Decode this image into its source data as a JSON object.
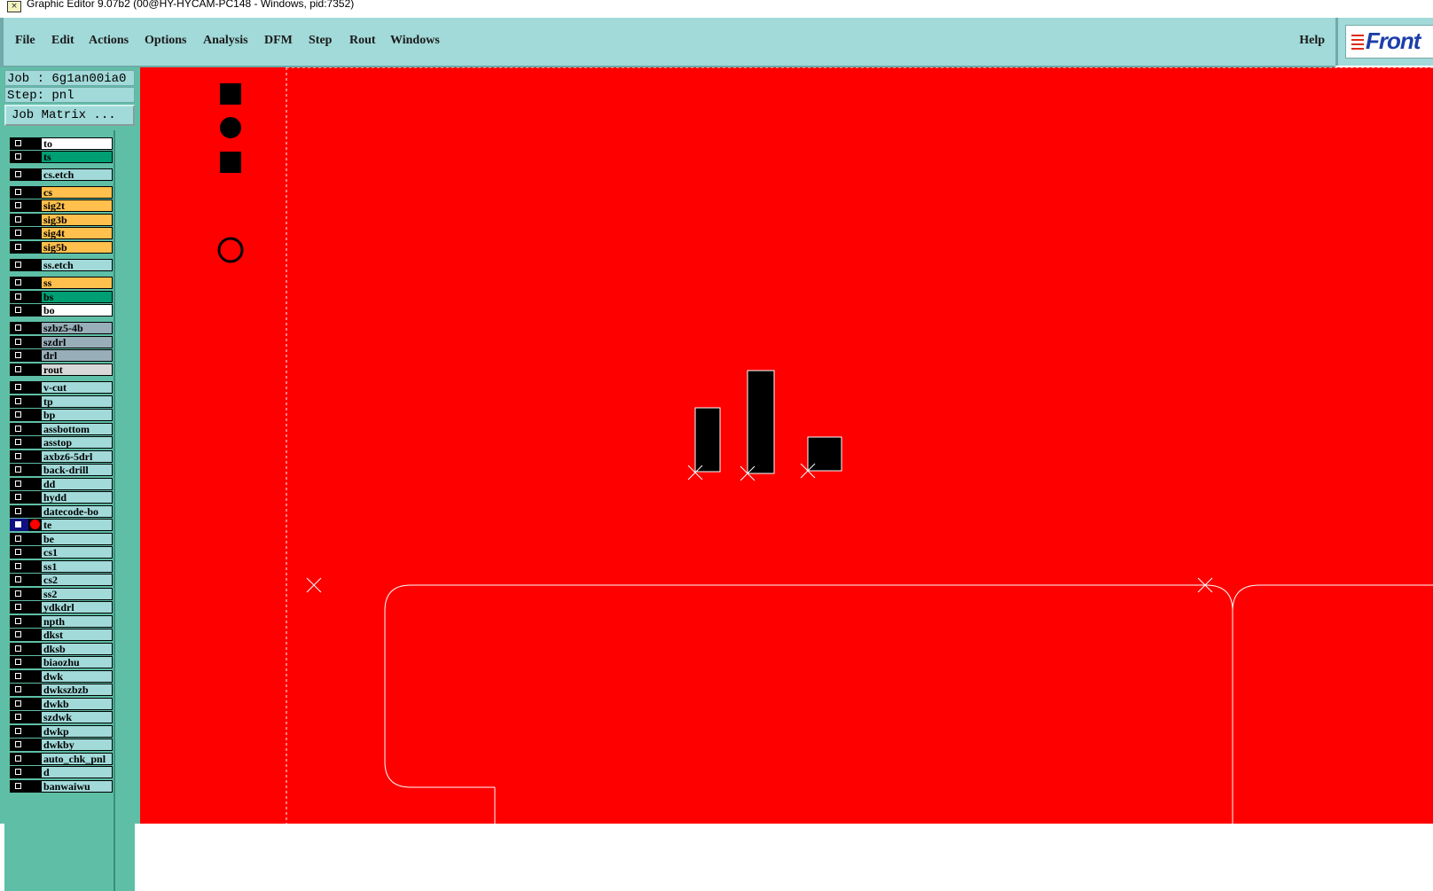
{
  "window": {
    "title": "Graphic Editor 9.07b2 (00@HY-HYCAM-PC148 - Windows, pid:7352)",
    "icon": "app-icon"
  },
  "menu": {
    "items": [
      "File",
      "Edit",
      "Actions",
      "Options",
      "Analysis",
      "DFM",
      "Step",
      "Rout",
      "Windows"
    ],
    "help": "Help"
  },
  "logo": {
    "text": "Front"
  },
  "job": {
    "job_label": "Job : 6g1an00ia0",
    "step_label": "Step: pnl",
    "matrix_button": "Job Matrix ..."
  },
  "layers": [
    {
      "name": "to",
      "color": "#ffffff"
    },
    {
      "name": "ts",
      "color": "#009e73"
    },
    {
      "name": "cs.etch",
      "color": "#a2d9d9"
    },
    {
      "name": "cs",
      "color": "#ffc04d"
    },
    {
      "name": "sig2t",
      "color": "#ffc04d"
    },
    {
      "name": "sig3b",
      "color": "#ffc04d"
    },
    {
      "name": "sig4t",
      "color": "#ffc04d"
    },
    {
      "name": "sig5b",
      "color": "#ffc04d"
    },
    {
      "name": "ss.etch",
      "color": "#a2d9d9"
    },
    {
      "name": "ss",
      "color": "#ffc04d"
    },
    {
      "name": "bs",
      "color": "#009e73"
    },
    {
      "name": "bo",
      "color": "#ffffff"
    },
    {
      "name": "szbz5-4b",
      "color": "#98aeb8"
    },
    {
      "name": "szdrl",
      "color": "#98aeb8"
    },
    {
      "name": "drl",
      "color": "#98aeb8"
    },
    {
      "name": "rout",
      "color": "#d8d8d8"
    },
    {
      "name": "v-cut",
      "color": "#a2d9d9"
    },
    {
      "name": "tp",
      "color": "#a2d9d9"
    },
    {
      "name": "bp",
      "color": "#a2d9d9"
    },
    {
      "name": "assbottom",
      "color": "#a2d9d9"
    },
    {
      "name": "asstop",
      "color": "#a2d9d9"
    },
    {
      "name": "axbz6-5drl",
      "color": "#a2d9d9"
    },
    {
      "name": "back-drill",
      "color": "#a2d9d9"
    },
    {
      "name": "dd",
      "color": "#a2d9d9"
    },
    {
      "name": "hydd",
      "color": "#a2d9d9"
    },
    {
      "name": "datecode-bo",
      "color": "#a2d9d9"
    },
    {
      "name": "te",
      "color": "#a2d9d9",
      "active": true
    },
    {
      "name": "be",
      "color": "#a2d9d9"
    },
    {
      "name": "cs1",
      "color": "#a2d9d9"
    },
    {
      "name": "ss1",
      "color": "#a2d9d9"
    },
    {
      "name": "cs2",
      "color": "#a2d9d9"
    },
    {
      "name": "ss2",
      "color": "#a2d9d9"
    },
    {
      "name": "ydkdrl",
      "color": "#a2d9d9"
    },
    {
      "name": "npth",
      "color": "#a2d9d9"
    },
    {
      "name": "dkst",
      "color": "#a2d9d9"
    },
    {
      "name": "dksb",
      "color": "#a2d9d9"
    },
    {
      "name": "biaozhu",
      "color": "#a2d9d9"
    },
    {
      "name": "dwk",
      "color": "#a2d9d9"
    },
    {
      "name": "dwkszbzb",
      "color": "#a2d9d9"
    },
    {
      "name": "dwkb",
      "color": "#a2d9d9"
    },
    {
      "name": "szdwk",
      "color": "#a2d9d9"
    },
    {
      "name": "dwkp",
      "color": "#a2d9d9"
    },
    {
      "name": "dwkby",
      "color": "#a2d9d9"
    },
    {
      "name": "auto_chk_pnl",
      "color": "#a2d9d9"
    },
    {
      "name": "d",
      "color": "#a2d9d9"
    },
    {
      "name": "banwaiwu",
      "color": "#a2d9d9"
    }
  ],
  "colors": {
    "canvas_bg": "#ff0000",
    "menu_bg": "#a2d9d9",
    "panel_bg": "#5fbfa6"
  }
}
